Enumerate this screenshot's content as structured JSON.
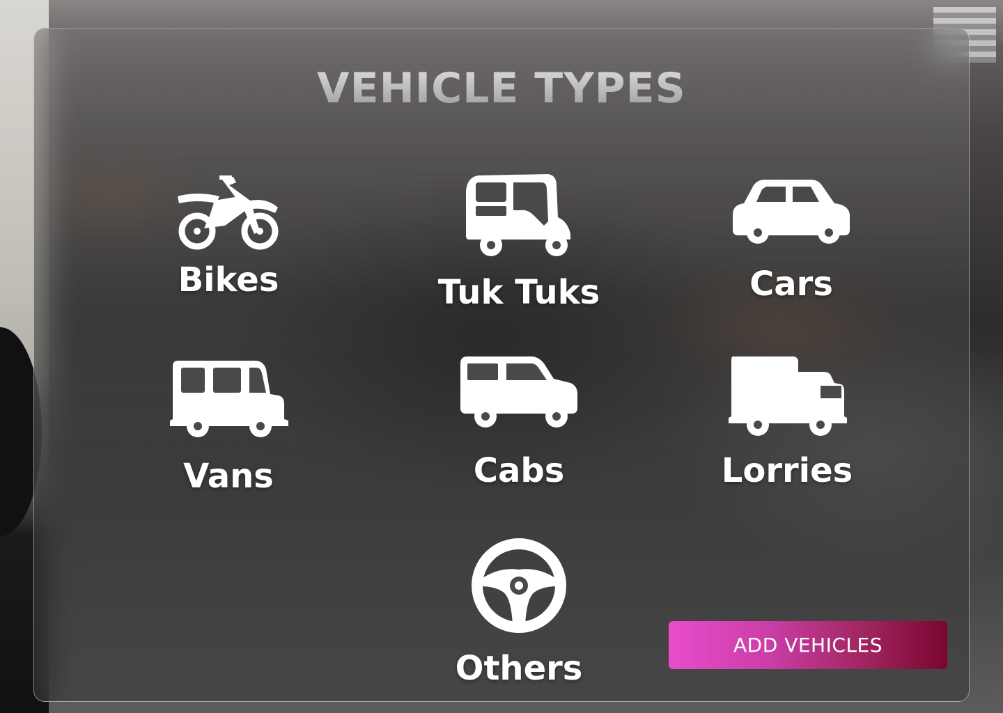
{
  "page": {
    "title": "VEHICLE TYPES"
  },
  "vehicle_types": [
    {
      "label": "Bikes",
      "icon": "motorcycle-icon"
    },
    {
      "label": "Tuk Tuks",
      "icon": "tuk-tuk-icon"
    },
    {
      "label": "Cars",
      "icon": "car-icon"
    },
    {
      "label": "Vans",
      "icon": "van-icon"
    },
    {
      "label": "Cabs",
      "icon": "cab-icon"
    },
    {
      "label": "Lorries",
      "icon": "lorry-icon"
    },
    {
      "label": "Others",
      "icon": "steering-wheel-icon"
    }
  ],
  "actions": {
    "add_vehicles_label": "ADD VEHICLES"
  },
  "colors": {
    "button_gradient_start": "#e84ccc",
    "button_gradient_end": "#7a0630",
    "label_text": "#ffffff"
  }
}
